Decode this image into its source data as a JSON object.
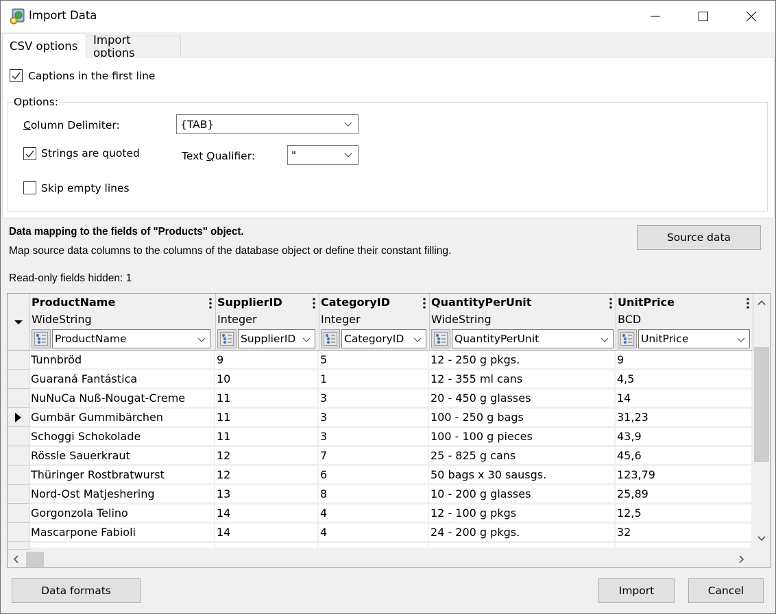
{
  "window": {
    "title": "Import Data",
    "controls": {
      "minimize": "minimize",
      "maximize": "maximize",
      "close": "close"
    }
  },
  "tabs": [
    {
      "label": "CSV options",
      "active": true
    },
    {
      "label": "Import options",
      "active": false
    }
  ],
  "csv_options": {
    "captions_first_line": {
      "label": "Captions in the first line",
      "checked": true
    },
    "options_group_title": "Options:",
    "column_delimiter": {
      "label_prefix": "",
      "label_access": "C",
      "label_rest": "olumn Delimiter:",
      "value": "{TAB}"
    },
    "strings_quoted": {
      "label": "Strings are quoted",
      "checked": true
    },
    "text_qualifier": {
      "label_prefix": "Text ",
      "label_access": "Q",
      "label_rest": "ualifier:",
      "value": "\""
    },
    "skip_empty_lines": {
      "label": "Skip empty lines",
      "checked": false
    }
  },
  "mapping": {
    "title": "Data mapping to the fields of \"Products\" object.",
    "description": "Map source data columns to the columns of the database object or define their constant filling.",
    "readonly_info": "Read-only fields hidden: 1",
    "source_data_button": "Source data"
  },
  "grid": {
    "columns": [
      {
        "name": "ProductName",
        "type": "WideString",
        "mapped_to": "ProductName"
      },
      {
        "name": "SupplierID",
        "type": "Integer",
        "mapped_to": "SupplierID"
      },
      {
        "name": "CategoryID",
        "type": "Integer",
        "mapped_to": "CategoryID"
      },
      {
        "name": "QuantityPerUnit",
        "type": "WideString",
        "mapped_to": "QuantityPerUnit"
      },
      {
        "name": "UnitPrice",
        "type": "BCD",
        "mapped_to": "UnitPrice"
      }
    ],
    "rows": [
      {
        "cells": [
          "Tunnbröd",
          "9",
          "5",
          "12 - 250 g pkgs.",
          "9"
        ],
        "current": false
      },
      {
        "cells": [
          "Guaraná Fantástica",
          "10",
          "1",
          "12 - 355 ml cans",
          "4,5"
        ],
        "current": false
      },
      {
        "cells": [
          "NuNuCa Nuß-Nougat-Creme",
          "11",
          "3",
          "20 - 450 g glasses",
          "14"
        ],
        "current": false
      },
      {
        "cells": [
          "Gumbär Gummibärchen",
          "11",
          "3",
          "100 - 250 g bags",
          "31,23"
        ],
        "current": true
      },
      {
        "cells": [
          "Schoggi Schokolade",
          "11",
          "3",
          "100 - 100 g pieces",
          "43,9"
        ],
        "current": false
      },
      {
        "cells": [
          "Rössle Sauerkraut",
          "12",
          "7",
          "25 - 825 g cans",
          "45,6"
        ],
        "current": false
      },
      {
        "cells": [
          "Thüringer Rostbratwurst",
          "12",
          "6",
          "50 bags x 30 sausgs.",
          "123,79"
        ],
        "current": false
      },
      {
        "cells": [
          "Nord-Ost Matjeshering",
          "13",
          "8",
          "10 - 200 g glasses",
          "25,89"
        ],
        "current": false
      },
      {
        "cells": [
          "Gorgonzola Telino",
          "14",
          "4",
          "12 - 100 g pkgs",
          "12,5"
        ],
        "current": false
      },
      {
        "cells": [
          "Mascarpone Fabioli",
          "14",
          "4",
          "24 - 200 g pkgs.",
          "32"
        ],
        "current": false
      }
    ]
  },
  "footer": {
    "data_formats_button": "Data formats",
    "import_button": "Import",
    "cancel_button": "Cancel"
  }
}
